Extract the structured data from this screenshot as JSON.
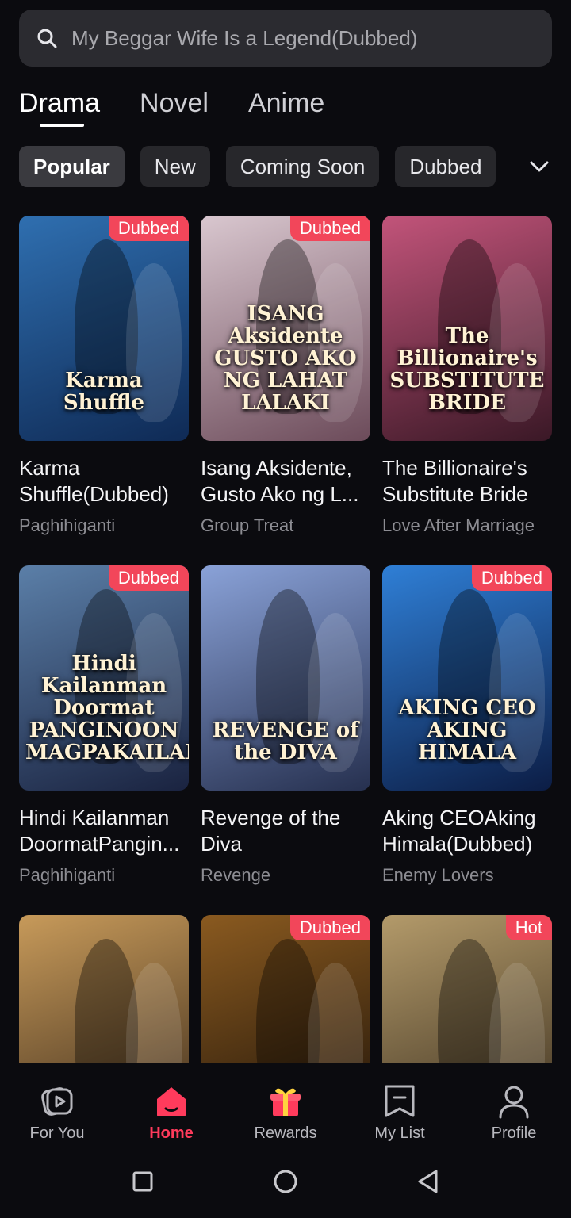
{
  "search": {
    "placeholder": "My Beggar Wife Is a Legend(Dubbed)",
    "icon": "search-icon"
  },
  "main_tabs": [
    {
      "label": "Drama",
      "active": true
    },
    {
      "label": "Novel",
      "active": false
    },
    {
      "label": "Anime",
      "active": false
    }
  ],
  "chips": [
    {
      "label": "Popular",
      "active": true
    },
    {
      "label": "New",
      "active": false
    },
    {
      "label": "Coming Soon",
      "active": false
    },
    {
      "label": "Dubbed",
      "active": false
    }
  ],
  "chips_dropdown_icon": "chevron-down-icon",
  "cards": [
    {
      "poster_title": "Karma Shuffle",
      "badge": "Dubbed",
      "title_line1": "Karma",
      "title_line2": "Shuffle(Dubbed)",
      "genre": "Paghihiganti",
      "colors": [
        "#2f6fb0",
        "#0f2a55"
      ]
    },
    {
      "poster_title": "ISANG Aksidente GUSTO AKO NG LAHAT LALAKI",
      "badge": "Dubbed",
      "title_line1": "Isang Aksidente,",
      "title_line2": "Gusto Ako ng L...",
      "genre": "Group Treat",
      "colors": [
        "#d9c7cf",
        "#6c4b5a"
      ]
    },
    {
      "poster_title": "The Billionaire's SUBSTITUTE BRIDE",
      "badge": "",
      "title_line1": "The Billionaire's",
      "title_line2": "Substitute Bride",
      "genre": "Love After Marriage",
      "colors": [
        "#c2547a",
        "#3a1826"
      ]
    },
    {
      "poster_title": "Hindi Kailanman Doormat PANGINOON MAGPAKAILANMAN",
      "badge": "Dubbed",
      "title_line1": "Hindi Kailanman",
      "title_line2": "DoormatPangin...",
      "genre": "Paghihiganti",
      "colors": [
        "#5b7fa8",
        "#1a2340"
      ]
    },
    {
      "poster_title": "REVENGE of the DIVA",
      "badge": "",
      "title_line1": "Revenge of the",
      "title_line2": "Diva",
      "genre": "Revenge",
      "colors": [
        "#8aa2d8",
        "#26304f"
      ]
    },
    {
      "poster_title": "AKING CEO AKING HIMALA",
      "badge": "Dubbed",
      "title_line1": "Aking CEOAking",
      "title_line2": "Himala(Dubbed)",
      "genre": "Enemy Lovers",
      "colors": [
        "#2f7fd6",
        "#0c1d45"
      ]
    },
    {
      "poster_title": "",
      "badge": "",
      "title_line1": "",
      "title_line2": "",
      "genre": "",
      "colors": [
        "#c79a5a",
        "#3b2a1a"
      ]
    },
    {
      "poster_title": "",
      "badge": "Dubbed",
      "title_line1": "",
      "title_line2": "",
      "genre": "",
      "colors": [
        "#8a5a20",
        "#1d1208"
      ]
    },
    {
      "poster_title": "",
      "badge": "Hot",
      "title_line1": "",
      "title_line2": "",
      "genre": "",
      "colors": [
        "#b39a6a",
        "#3a2e1e"
      ]
    }
  ],
  "bottom_nav": [
    {
      "label": "For You",
      "icon": "play-icon",
      "active": false
    },
    {
      "label": "Home",
      "icon": "home-icon",
      "active": true
    },
    {
      "label": "Rewards",
      "icon": "gift-icon",
      "active": false
    },
    {
      "label": "My List",
      "icon": "bookmark-icon",
      "active": false
    },
    {
      "label": "Profile",
      "icon": "profile-icon",
      "active": false
    }
  ],
  "colors": {
    "accent": "#ff3b5c",
    "badge": "#f2465a",
    "background": "#0b0b0f"
  }
}
